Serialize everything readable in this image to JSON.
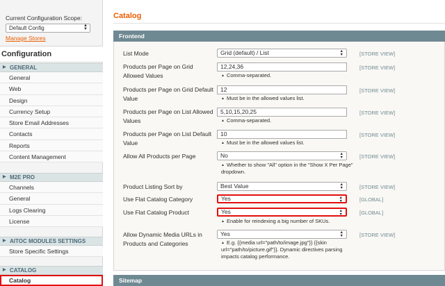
{
  "sidebar": {
    "scope_label": "Current Configuration Scope:",
    "scope_value": "Default Config",
    "manage_stores": "Manage Stores",
    "title": "Configuration",
    "groups": [
      {
        "title": "GENERAL",
        "items": [
          "General",
          "Web",
          "Design",
          "Currency Setup",
          "Store Email Addresses",
          "Contacts",
          "Reports",
          "Content Management"
        ]
      },
      {
        "title": "M2E PRO",
        "items": [
          "Channels",
          "General",
          "Logs Clearing",
          "License"
        ]
      },
      {
        "title": "AITOC MODULES SETTINGS",
        "items": [
          "Store Specific Settings"
        ]
      },
      {
        "title": "CATALOG",
        "items": [
          "Catalog"
        ]
      }
    ],
    "active_item": "Catalog"
  },
  "main": {
    "title": "Catalog",
    "section_frontend": "Frontend",
    "section_sitemap": "Sitemap",
    "rows": [
      {
        "label": "List Mode",
        "type": "select",
        "value": "Grid (default) / List",
        "scope": "[STORE VIEW]"
      },
      {
        "label": "Products per Page on Grid Allowed Values",
        "type": "input",
        "value": "12,24,36",
        "hint": "Comma-separated.",
        "scope": "[STORE VIEW]"
      },
      {
        "label": "Products per Page on Grid Default Value",
        "type": "input",
        "value": "12",
        "hint": "Must be in the allowed values list.",
        "scope": "[STORE VIEW]"
      },
      {
        "label": "Products per Page on List Allowed Values",
        "type": "input",
        "value": "5,10,15,20,25",
        "hint": "Comma-separated.",
        "scope": "[STORE VIEW]"
      },
      {
        "label": "Products per Page on List Default Value",
        "type": "input",
        "value": "10",
        "hint": "Must be in the allowed values list.",
        "scope": "[STORE VIEW]"
      },
      {
        "label": "Allow All Products per Page",
        "type": "select",
        "value": "No",
        "hint": "Whether to show \"All\" option in the \"Show X Per Page\" dropdown.",
        "scope": "[STORE VIEW]"
      },
      {
        "label": "Product Listing Sort by",
        "type": "select",
        "value": "Best Value",
        "scope": "[STORE VIEW]"
      },
      {
        "label": "Use Flat Catalog Category",
        "type": "select",
        "value": "Yes",
        "scope": "[GLOBAL]",
        "highlight": true
      },
      {
        "label": "Use Flat Catalog Product",
        "type": "select",
        "value": "Yes",
        "hint": "Enable for reindexing a big number of SKUs.",
        "scope": "[GLOBAL]",
        "highlight": true
      },
      {
        "label": "Allow Dynamic Media URLs in Products and Categories",
        "type": "select",
        "value": "Yes",
        "hint": "E.g. {{media url=\"path/to/image.jpg\"}} {{skin url=\"path/to/picture.gif\"}}. Dynamic directives parsing impacts catalog performance.",
        "scope": "[STORE VIEW]"
      }
    ]
  },
  "colors": {
    "accent": "#eb5e00",
    "section_header": "#6f8992",
    "nav_header": "#dbe4e5",
    "highlight": "#e30e0e"
  }
}
